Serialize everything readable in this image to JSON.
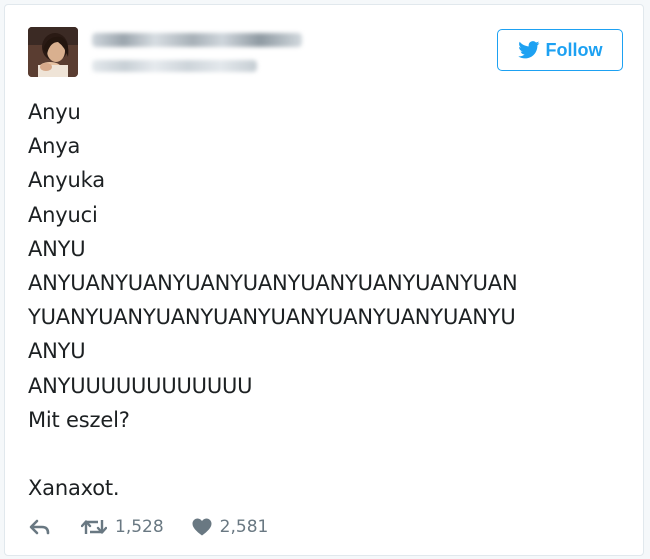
{
  "tweet": {
    "follow_label": "Follow",
    "lines": [
      "Anyu",
      "Anya",
      "Anyuka",
      "Anyuci",
      "ANYU",
      "ANYUANYUANYUANYUANYUANYUANYUANYUAN",
      "YUANYUANYUANYUANYUANYUANYUANYUANYU",
      "ANYU",
      "ANYUUUUUUUUUUUU",
      "Mit eszel?",
      "Xanaxot."
    ],
    "retweet_count": "1,528",
    "like_count": "2,581"
  },
  "colors": {
    "brand_blue": "#1da1f2",
    "text": "#1c2022",
    "muted": "#697882"
  },
  "icons": {
    "follow": "twitter-bird-icon",
    "reply": "reply-icon",
    "retweet": "retweet-icon",
    "like": "heart-icon"
  }
}
